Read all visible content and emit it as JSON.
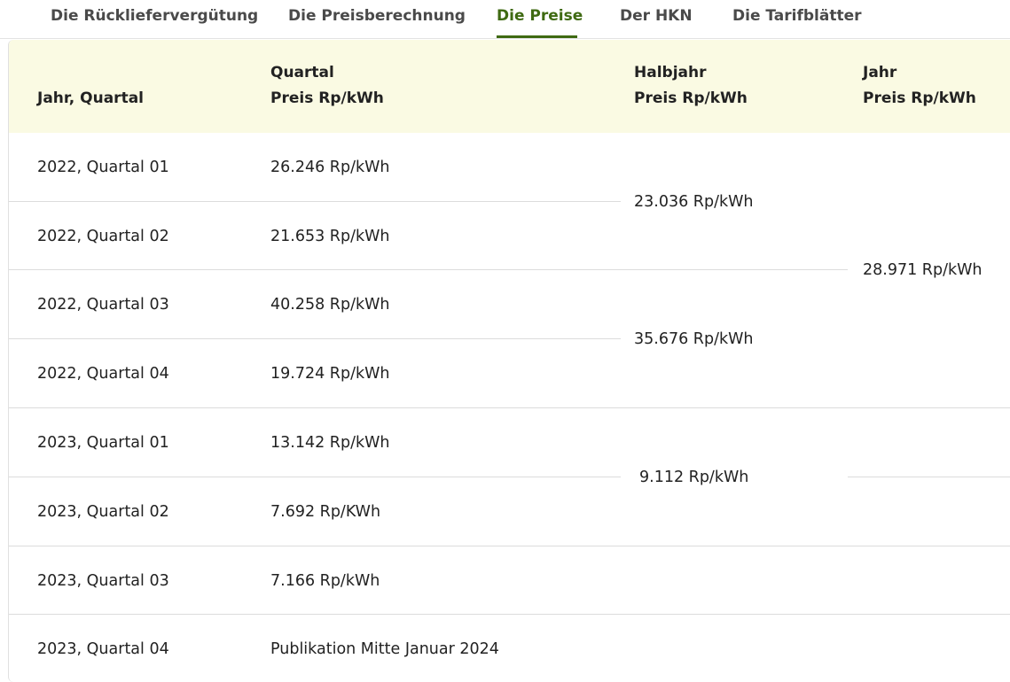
{
  "tabs": [
    {
      "label": "Die Rückliefervergütung",
      "active": false
    },
    {
      "label": "Die Preisberechnung",
      "active": false
    },
    {
      "label": "Die Preise",
      "active": true
    },
    {
      "label": "Der HKN",
      "active": false
    },
    {
      "label": "Die Tarifblätter",
      "active": false
    }
  ],
  "colors": {
    "accent": "#3f6a12",
    "header_bg": "#fafae3",
    "divider": "#dcdcdc"
  },
  "table": {
    "headers": {
      "period": "Jahr, Quartal",
      "quarter_line1": "Quartal",
      "quarter_line2": "Preis Rp/kWh",
      "half_line1": "Halbjahr",
      "half_line2": "Preis Rp/kWh",
      "year_line1": "Jahr",
      "year_line2": "Preis Rp/kWh"
    },
    "rows": [
      {
        "period": "2022, Quartal 01",
        "quarter_price": "26.246 Rp/kWh"
      },
      {
        "period": "2022, Quartal 02",
        "quarter_price": "21.653 Rp/kWh"
      },
      {
        "period": "2022, Quartal 03",
        "quarter_price": "40.258 Rp/kWh"
      },
      {
        "period": "2022, Quartal 04",
        "quarter_price": "19.724 Rp/kWh"
      },
      {
        "period": "2023, Quartal 01",
        "quarter_price": "13.142 Rp/kWh"
      },
      {
        "period": "2023, Quartal 02",
        "quarter_price": "7.692 Rp/KWh"
      },
      {
        "period": "2023, Quartal 03",
        "quarter_price": "7.166 Rp/kWh"
      },
      {
        "period": "2023, Quartal 04",
        "quarter_price": "Publikation Mitte Januar 2024"
      }
    ],
    "half_year_prices": [
      {
        "label": "23.036 Rp/kWh",
        "rows": "2022 Q01–Q02"
      },
      {
        "label": "35.676 Rp/kWh",
        "rows": "2022 Q03–Q04"
      },
      {
        "label": "9.112 Rp/kWh",
        "rows": "2023 Q01–Q02"
      }
    ],
    "year_prices": [
      {
        "label": "28.971 Rp/kWh",
        "rows": "2022"
      }
    ]
  }
}
